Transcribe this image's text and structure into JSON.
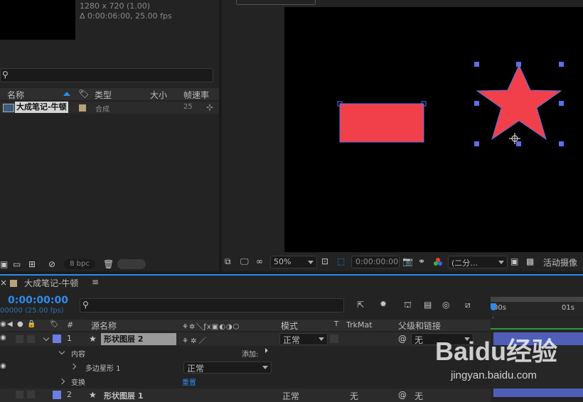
{
  "project": {
    "info_line1": "1280 x 720 (1.00)",
    "info_line2": "Δ 0:00:06:00, 25.00 fps",
    "search_placeholder": "",
    "columns": {
      "name": "名称",
      "type": "类型",
      "size": "大小",
      "fps": "帧速率"
    },
    "item": {
      "name": "大成笔记-牛顿",
      "type": "合成",
      "fps": "25"
    },
    "bpc": "8 bpc"
  },
  "viewer": {
    "zoom": "50%",
    "timecode": "0:00:00:00",
    "resolution": "(二分…",
    "camera": "活动摄像",
    "top_tab": "———"
  },
  "timeline": {
    "tab_title": "大成笔记-牛顿",
    "timecode": "0:00:00:00",
    "frame_info": "00000 (25.00 fps)",
    "columns": {
      "num": "#",
      "source_name": "源名称",
      "mode": "模式",
      "t": "T",
      "trkmat": "TrkMat",
      "parent": "父级和链接"
    },
    "ruler": {
      "start": "00s",
      "one": "01s"
    },
    "layer1": {
      "num": "1",
      "name": "形状图层 2",
      "mode": "正常",
      "parent": "无"
    },
    "contents": {
      "label": "内容",
      "add": "添加:"
    },
    "polystar": {
      "label": "多边星形 1",
      "mode": "正常"
    },
    "transform": {
      "label": "变换",
      "reset": "重置"
    },
    "layer2": {
      "num": "2",
      "name": "形状图层 1",
      "mode": "正常",
      "trkmat": "无",
      "parent": "无"
    }
  },
  "watermark": {
    "brand": "Baidu经验",
    "url": "jingyan.baidu.com"
  },
  "colors": {
    "shape_fill": "#f2404a",
    "handle": "#5b6fe8",
    "accent": "#2d8ceb",
    "label_blue": "#6a7fe0",
    "label_tan": "#b8a27a"
  }
}
